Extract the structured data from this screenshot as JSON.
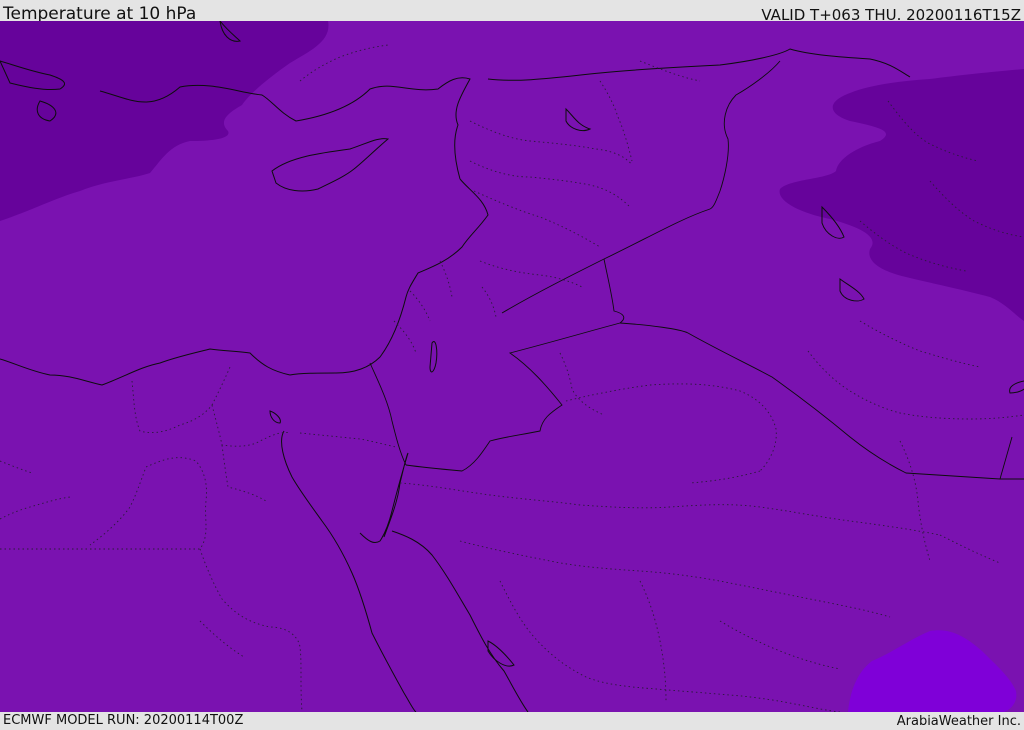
{
  "header": {
    "title": "Temperature at 10 hPa",
    "valid": "VALID T+063 THU. 20200116T15Z"
  },
  "footer": {
    "model_run": "ECMWF MODEL RUN: 20200114T00Z",
    "credit": "ArabiaWeather Inc."
  },
  "map": {
    "region": "Eastern Mediterranean and Middle East",
    "colors": {
      "base": "#7a12b0",
      "cold": "#66039b",
      "warm": "#7f00d8",
      "coast": "#0d0d0d",
      "border_dotted": "#2a1a3a"
    }
  }
}
